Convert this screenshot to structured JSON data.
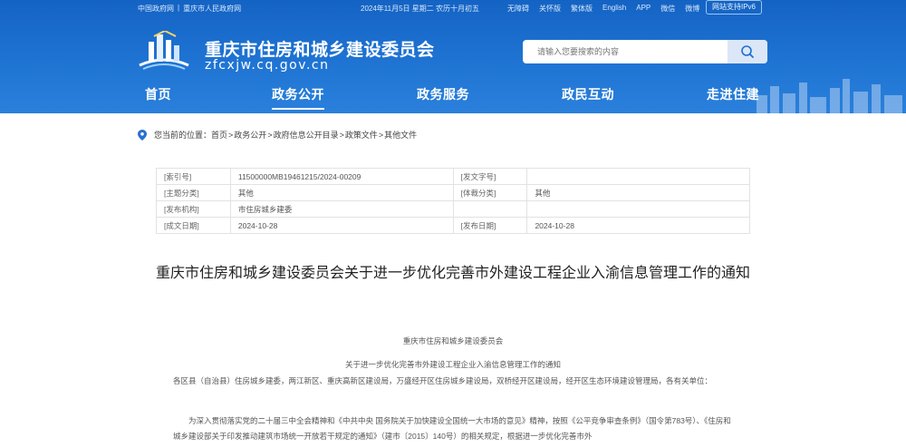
{
  "topbar": {
    "links_left": [
      "中国政府网",
      "重庆市人民政府网"
    ],
    "date": "2024年11月5日 星期二 农历十月初五",
    "links_right": [
      "无障碍",
      "关怀版",
      "繁体版",
      "English",
      "APP",
      "微信",
      "微博"
    ],
    "ipv6": "网站支持IPv6"
  },
  "header": {
    "title": "重庆市住房和城乡建设委员会",
    "domain": "zfcxjw.cq.gov.cn",
    "search_placeholder": "请输入您要搜索的内容"
  },
  "nav": [
    "首页",
    "政务公开",
    "政务服务",
    "政民互动",
    "走进住建"
  ],
  "breadcrumb": {
    "label": "您当前的位置：",
    "items": [
      "首页",
      "政务公开",
      "政府信息公开目录",
      "政策文件",
      "其他文件"
    ]
  },
  "meta": {
    "rows": [
      [
        "[索引号]",
        "11500000MB19461215/2024-00209",
        "[发文字号]",
        ""
      ],
      [
        "[主题分类]",
        "其他",
        "[体裁分类]",
        "其他"
      ],
      [
        "[发布机构]",
        "市住房城乡建委",
        "",
        ""
      ],
      [
        "[成文日期]",
        "2024-10-28",
        "[发布日期]",
        "2024-10-28"
      ]
    ]
  },
  "article": {
    "title": "重庆市住房和城乡建设委员会关于进一步优化完善市外建设工程企业入渝信息管理工作的通知",
    "issuer": "重庆市住房和城乡建设委员会",
    "subtitle": "关于进一步优化完善市外建设工程企业入渝信息管理工作的通知",
    "para1": "各区县（自治县）住房城乡建委，两江新区、重庆高新区建设局，万盛经开区住房城乡建设局，双桥经开区建设局，经开区生态环境建设管理局，各有关单位：",
    "para2": "为深入贯彻落实党的二十届三中全会精神和《中共中央 国务院关于加快建设全国统一大市场的意见》精神，按照《公平竞争审查条例》（国令第783号）、《住房和城乡建设部关于印发推动建筑市场统一开放若干规定的通知》（建市〔2015〕140号）的相关规定，根据进一步优化完善市外"
  }
}
